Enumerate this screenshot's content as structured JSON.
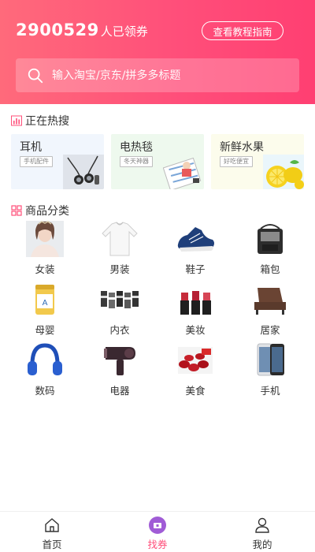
{
  "header": {
    "count": "2900529",
    "count_suffix": "人已领券",
    "guide_button": "查看教程指南",
    "search_placeholder": "输入淘宝/京东/拼多多标题"
  },
  "hot_search": {
    "title": "正在热搜",
    "cards": [
      {
        "title": "耳机",
        "tag": "手机配件",
        "bg": "#f1f6fd"
      },
      {
        "title": "电热毯",
        "tag": "冬天神器",
        "bg": "#eef9ee"
      },
      {
        "title": "新鲜水果",
        "tag": "好吃便宜",
        "bg": "#fcfcec"
      }
    ]
  },
  "categories": {
    "title": "商品分类",
    "items": [
      {
        "label": "女装"
      },
      {
        "label": "男装"
      },
      {
        "label": "鞋子"
      },
      {
        "label": "箱包"
      },
      {
        "label": "母婴"
      },
      {
        "label": "内衣"
      },
      {
        "label": "美妆"
      },
      {
        "label": "居家"
      },
      {
        "label": "数码"
      },
      {
        "label": "电器"
      },
      {
        "label": "美食"
      },
      {
        "label": "手机"
      }
    ]
  },
  "bottom_nav": {
    "items": [
      {
        "label": "首页"
      },
      {
        "label": "找券",
        "active": true
      },
      {
        "label": "我的"
      }
    ]
  },
  "colors": {
    "accent": "#ff4f7a",
    "header_start": "#ff6a7b",
    "header_end": "#ff3f72"
  }
}
